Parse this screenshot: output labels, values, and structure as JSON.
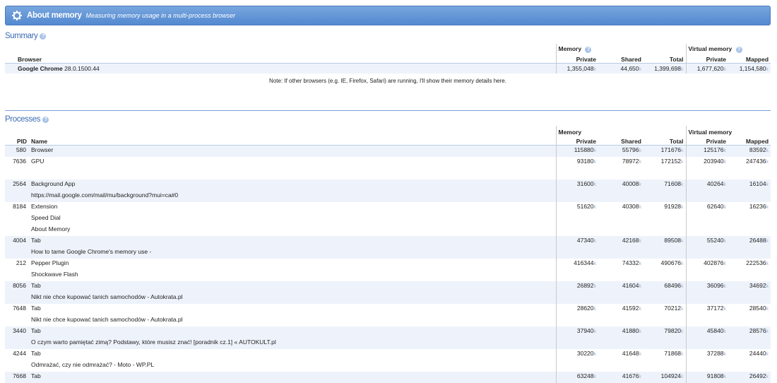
{
  "header": {
    "title": "About memory",
    "subtitle": "Measuring memory usage in a multi-process browser"
  },
  "summary": {
    "title": "Summary",
    "help": "?",
    "group_memory": "Memory",
    "group_virtual": "Virtual memory",
    "col_browser": "Browser",
    "col_private": "Private",
    "col_shared": "Shared",
    "col_total": "Total",
    "col_vprivate": "Private",
    "col_mapped": "Mapped",
    "unit": "k",
    "row": {
      "name": "Google Chrome",
      "version": "28.0.1500.44",
      "private": "1,355,048",
      "shared": "44,650",
      "total": "1,399,698",
      "vprivate": "1,677,620",
      "mapped": "1,154,580"
    },
    "note": "Note: If other browsers (e.g. IE, Firefox, Safari) are running, I'll show their memory details here."
  },
  "processes": {
    "title": "Processes",
    "help": "?",
    "group_memory": "Memory",
    "group_virtual": "Virtual memory",
    "col_pid": "PID",
    "col_name": "Name",
    "col_private": "Private",
    "col_shared": "Shared",
    "col_total": "Total",
    "col_vprivate": "Private",
    "col_mapped": "Mapped",
    "unit": "k",
    "rows": [
      {
        "pid": "580",
        "names": [
          "Browser"
        ],
        "private": "115880",
        "shared": "55796",
        "total": "171676",
        "vprivate": "125176",
        "mapped": "83592"
      },
      {
        "pid": "7636",
        "names": [
          "GPU",
          ""
        ],
        "private": "93180",
        "shared": "78972",
        "total": "172152",
        "vprivate": "203940",
        "mapped": "247436"
      },
      {
        "pid": "2564",
        "names": [
          "Background App",
          "https://mail.google.com/mail/mu/background?mui=ca#0"
        ],
        "private": "31600",
        "shared": "40008",
        "total": "71608",
        "vprivate": "40264",
        "mapped": "16104"
      },
      {
        "pid": "8184",
        "names": [
          "Extension",
          "Speed Dial",
          "About Memory"
        ],
        "private": "51620",
        "shared": "40308",
        "total": "91928",
        "vprivate": "62640",
        "mapped": "16236"
      },
      {
        "pid": "4004",
        "names": [
          "Tab",
          "How to tame Google Chrome's memory use -"
        ],
        "private": "47340",
        "shared": "42168",
        "total": "89508",
        "vprivate": "55240",
        "mapped": "26488"
      },
      {
        "pid": "212",
        "names": [
          "Pepper Plugin",
          "Shockwave Flash"
        ],
        "private": "416344",
        "shared": "74332",
        "total": "490676",
        "vprivate": "402876",
        "mapped": "222536"
      },
      {
        "pid": "8056",
        "names": [
          "Tab",
          "Nikt nie chce kupować tanich samochodów - Autokrata.pl"
        ],
        "private": "26892",
        "shared": "41604",
        "total": "68496",
        "vprivate": "36096",
        "mapped": "34692"
      },
      {
        "pid": "7648",
        "names": [
          "Tab",
          "Nikt nie chce kupować tanich samochodów - Autokrata.pl"
        ],
        "private": "28620",
        "shared": "41592",
        "total": "70212",
        "vprivate": "37172",
        "mapped": "28540"
      },
      {
        "pid": "3440",
        "names": [
          "Tab",
          "O czym warto pamiętać zimą? Podstawy, które musisz znać! [poradnik cz.1] « AUTOKULT.pl"
        ],
        "private": "37940",
        "shared": "41880",
        "total": "79820",
        "vprivate": "45840",
        "mapped": "28576"
      },
      {
        "pid": "4244",
        "names": [
          "Tab",
          "Odmrażać, czy nie odmrażać? - Moto - WP.PL"
        ],
        "private": "30220",
        "shared": "41648",
        "total": "71868",
        "vprivate": "37288",
        "mapped": "24440"
      },
      {
        "pid": "7668",
        "names": [
          "Tab"
        ],
        "private": "63248",
        "shared": "41676",
        "total": "104924",
        "vprivate": "91808",
        "mapped": "26492"
      }
    ]
  }
}
